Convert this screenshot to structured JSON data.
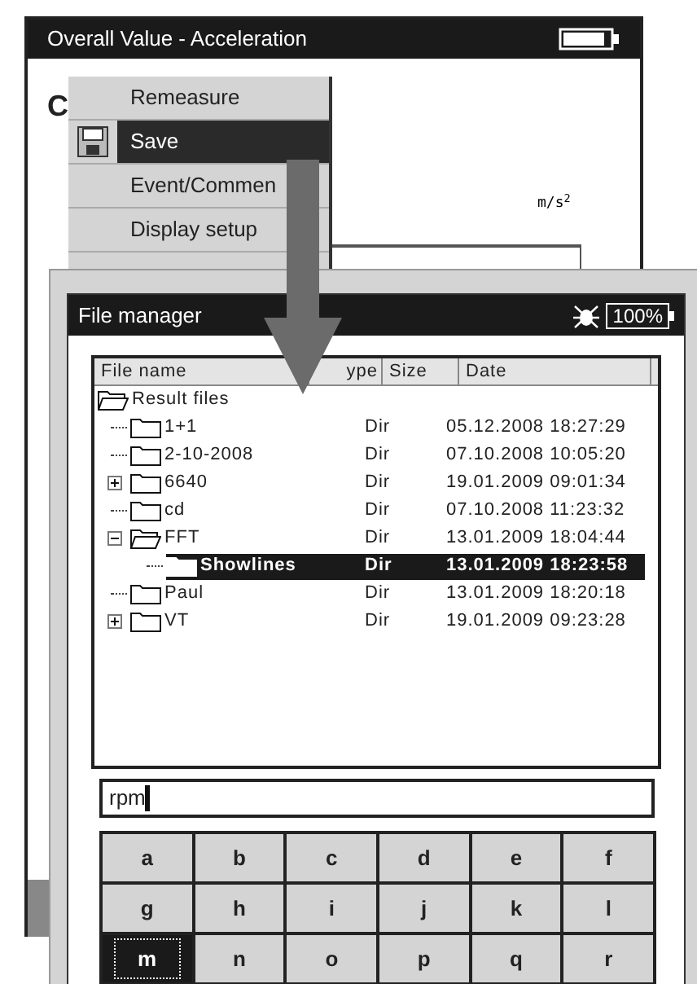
{
  "background_window": {
    "title": "Overall Value - Acceleration",
    "heading": "C",
    "unit": "m/s$^{2}$"
  },
  "context_menu": [
    {
      "label": "Remeasure",
      "selected": false,
      "kind": "plain"
    },
    {
      "label": "Save",
      "selected": true,
      "kind": "with_icon"
    },
    {
      "label": "Event/Commen",
      "selected": false,
      "kind": "plain"
    },
    {
      "label": "Display setup",
      "selected": false,
      "kind": "plain"
    }
  ],
  "file_manager": {
    "title": "File manager",
    "battery": "100%",
    "columns": [
      "File name",
      "ype",
      "Size",
      "Date"
    ],
    "tree": [
      {
        "name": "Result files",
        "open": true,
        "selected": false,
        "children": [
          {
            "name": "1+1",
            "type": "Dir",
            "date": "05.12.2008 18:27:29",
            "selected": false
          },
          {
            "name": "2-10-2008",
            "type": "Dir",
            "date": "07.10.2008 10:05:20",
            "selected": false
          },
          {
            "name": "6640",
            "type": "Dir",
            "date": "19.01.2009 09:01:34",
            "selected": false,
            "expanded": false
          },
          {
            "name": "cd",
            "type": "Dir",
            "date": "07.10.2008 11:23:32",
            "selected": false
          },
          {
            "name": "FFT",
            "type": "Dir",
            "date": "13.01.2009 18:04:44",
            "selected": false,
            "expanded": true,
            "open": true,
            "children": [
              {
                "name": "Showlines",
                "type": "Dir",
                "date": "13.01.2009 18:23:58",
                "selected": true
              }
            ]
          },
          {
            "name": "Paul",
            "type": "Dir",
            "date": "13.01.2009 18:20:18",
            "selected": false
          },
          {
            "name": "VT",
            "type": "Dir",
            "date": "19.01.2009 09:23:28",
            "selected": false,
            "expanded": false
          }
        ]
      }
    ]
  },
  "input": {
    "value": "rpm"
  },
  "keys": [
    {
      "label": "a",
      "selected": false
    },
    {
      "label": "b",
      "selected": false
    },
    {
      "label": "c",
      "selected": false
    },
    {
      "label": "d",
      "selected": false
    },
    {
      "label": "e",
      "selected": false
    },
    {
      "label": "f",
      "selected": false
    },
    {
      "label": "g",
      "selected": false
    },
    {
      "label": "h",
      "selected": false
    },
    {
      "label": "i",
      "selected": false
    },
    {
      "label": "j",
      "selected": false
    },
    {
      "label": "k",
      "selected": false
    },
    {
      "label": "l",
      "selected": false
    },
    {
      "label": "m",
      "selected": true
    },
    {
      "label": "n",
      "selected": false
    },
    {
      "label": "o",
      "selected": false
    },
    {
      "label": "p",
      "selected": false
    },
    {
      "label": "q",
      "selected": false
    },
    {
      "label": "r",
      "selected": false
    }
  ]
}
